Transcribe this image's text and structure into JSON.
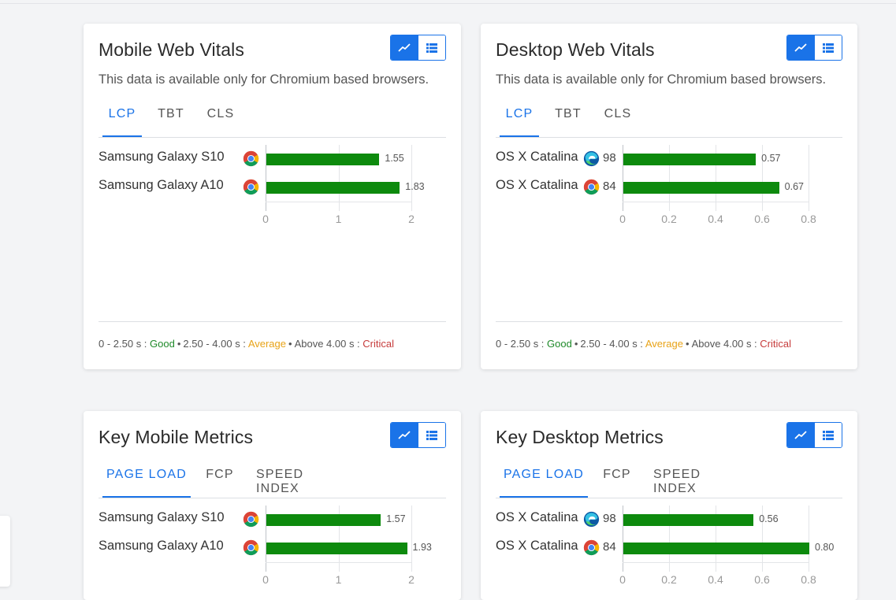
{
  "cards": [
    {
      "title": "Mobile Web Vitals",
      "subtitle": "This data is available only for Chromium based browsers.",
      "tabs": [
        "LCP",
        "TBT",
        "CLS"
      ],
      "active_tab": 0,
      "rows": [
        {
          "label": "Samsung Galaxy S10",
          "browser_icon": "chrome-icon",
          "score": "",
          "value": 1.55,
          "value_label": "1.55"
        },
        {
          "label": "Samsung Galaxy A10",
          "browser_icon": "chrome-icon",
          "score": "",
          "value": 1.83,
          "value_label": "1.83"
        }
      ],
      "ticks": [
        "0",
        "1",
        "2"
      ],
      "legend": {
        "good_range": "0 - 2.50 s : ",
        "good": "Good",
        "avg_range": "2.50 - 4.00 s : ",
        "avg": "Average",
        "crit_range": "Above 4.00 s : ",
        "crit": "Critical"
      }
    },
    {
      "title": "Desktop Web Vitals",
      "subtitle": "This data is available only for Chromium based browsers.",
      "tabs": [
        "LCP",
        "TBT",
        "CLS"
      ],
      "active_tab": 0,
      "rows": [
        {
          "label": "OS X Catalina",
          "browser_icon": "edge-icon",
          "score": "98",
          "value": 0.57,
          "value_label": "0.57"
        },
        {
          "label": "OS X Catalina",
          "browser_icon": "chrome-icon",
          "score": "84",
          "value": 0.67,
          "value_label": "0.67"
        }
      ],
      "ticks": [
        "0",
        "0.2",
        "0.4",
        "0.6",
        "0.8"
      ],
      "legend": {
        "good_range": "0 - 2.50 s : ",
        "good": "Good",
        "avg_range": "2.50 - 4.00 s : ",
        "avg": "Average",
        "crit_range": "Above 4.00 s : ",
        "crit": "Critical"
      }
    },
    {
      "title": "Key Mobile Metrics",
      "tabs": [
        "PAGE LOAD",
        "FCP",
        "SPEED INDEX"
      ],
      "active_tab": 0,
      "rows": [
        {
          "label": "Samsung Galaxy S10",
          "browser_icon": "chrome-icon",
          "score": "",
          "value": 1.57,
          "value_label": "1.57"
        },
        {
          "label": "Samsung Galaxy A10",
          "browser_icon": "chrome-icon",
          "score": "",
          "value": 1.93,
          "value_label": "1.93"
        }
      ],
      "ticks": [
        "0",
        "1",
        "2"
      ]
    },
    {
      "title": "Key Desktop Metrics",
      "tabs": [
        "PAGE LOAD",
        "FCP",
        "SPEED INDEX"
      ],
      "active_tab": 0,
      "rows": [
        {
          "label": "OS X Catalina",
          "browser_icon": "edge-icon",
          "score": "98",
          "value": 0.56,
          "value_label": "0.56"
        },
        {
          "label": "OS X Catalina",
          "browser_icon": "chrome-icon",
          "score": "84",
          "value": 0.8,
          "value_label": "0.80"
        }
      ],
      "ticks": [
        "0",
        "0.2",
        "0.4",
        "0.6",
        "0.8"
      ]
    }
  ],
  "chart_data": [
    {
      "type": "bar",
      "orientation": "horizontal",
      "title": "Mobile Web Vitals - LCP",
      "categories": [
        "Samsung Galaxy S10",
        "Samsung Galaxy A10"
      ],
      "values": [
        1.55,
        1.83
      ],
      "xlim": [
        0,
        2
      ],
      "color": "#0d8a0d"
    },
    {
      "type": "bar",
      "orientation": "horizontal",
      "title": "Desktop Web Vitals - LCP",
      "categories": [
        "OS X Catalina",
        "OS X Catalina"
      ],
      "values": [
        0.57,
        0.67
      ],
      "xlim": [
        0,
        0.8
      ],
      "color": "#0d8a0d"
    },
    {
      "type": "bar",
      "orientation": "horizontal",
      "title": "Key Mobile Metrics - PAGE LOAD",
      "categories": [
        "Samsung Galaxy S10",
        "Samsung Galaxy A10"
      ],
      "values": [
        1.57,
        1.93
      ],
      "xlim": [
        0,
        2
      ],
      "color": "#0d8a0d"
    },
    {
      "type": "bar",
      "orientation": "horizontal",
      "title": "Key Desktop Metrics - PAGE LOAD",
      "categories": [
        "OS X Catalina",
        "OS X Catalina"
      ],
      "values": [
        0.56,
        0.8
      ],
      "xlim": [
        0,
        0.8
      ],
      "color": "#0d8a0d"
    }
  ],
  "colors": {
    "accent": "#1a73e8",
    "bar": "#0d8a0d",
    "good": "#1f8a2a",
    "average": "#e8a317",
    "critical": "#c63b3b"
  },
  "icons": {
    "chart_view": "line-chart-icon",
    "table_view": "list-icon"
  }
}
